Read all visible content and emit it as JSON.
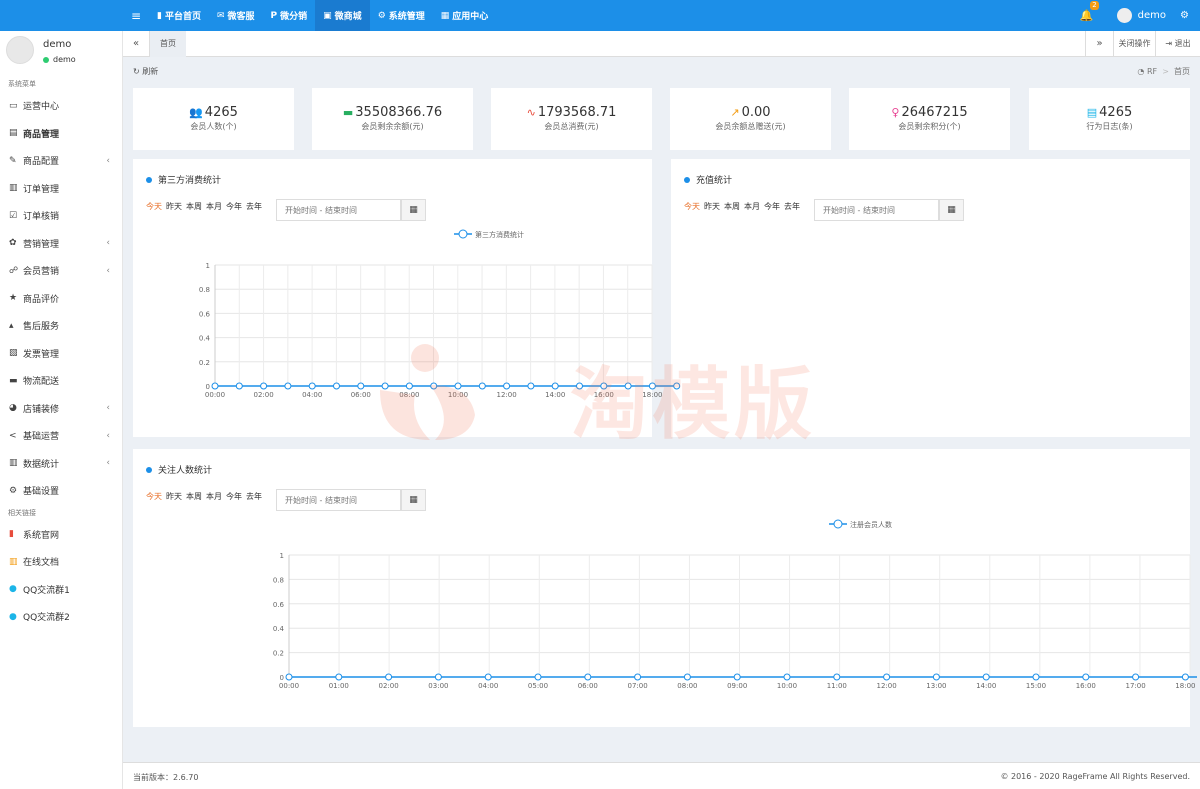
{
  "topbar": {
    "menu_icon": "menu-icon",
    "nav": [
      {
        "label": "平台首页",
        "icon": "bookmark-icon",
        "active": false
      },
      {
        "label": "微客服",
        "icon": "comments-icon",
        "active": false
      },
      {
        "label": "微分销",
        "icon": "p-icon",
        "active": false
      },
      {
        "label": "微商城",
        "icon": "shopping-bag-icon",
        "active": true
      },
      {
        "label": "系统管理",
        "icon": "cogs-icon",
        "active": false
      },
      {
        "label": "应用中心",
        "icon": "app-grid-icon",
        "active": false
      }
    ],
    "notification_count": "2",
    "username": "demo",
    "accent": "#1c8fe8"
  },
  "sidebar": {
    "profile_name": "demo",
    "profile_status": "demo",
    "section_system": "系统菜单",
    "items": [
      {
        "label": "运营中心",
        "icon": "desktop-icon",
        "arrow": false,
        "active": false
      },
      {
        "label": "商品管理",
        "icon": "archive-icon",
        "arrow": false,
        "active": true
      },
      {
        "label": "商品配置",
        "icon": "pencil-icon",
        "arrow": true,
        "active": false
      },
      {
        "label": "订单管理",
        "icon": "list-icon",
        "arrow": false,
        "active": false
      },
      {
        "label": "订单核销",
        "icon": "check-list-icon",
        "arrow": false,
        "active": false
      },
      {
        "label": "营销管理",
        "icon": "gift-icon",
        "arrow": true,
        "active": false
      },
      {
        "label": "会员营销",
        "icon": "handshake-icon",
        "arrow": true,
        "active": false
      },
      {
        "label": "商品评价",
        "icon": "star-icon",
        "arrow": false,
        "active": false
      },
      {
        "label": "售后服务",
        "icon": "fire-extinguisher-icon",
        "arrow": false,
        "active": false
      },
      {
        "label": "发票管理",
        "icon": "invoice-icon",
        "arrow": false,
        "active": false
      },
      {
        "label": "物流配送",
        "icon": "truck-icon",
        "arrow": false,
        "active": false
      },
      {
        "label": "店铺装修",
        "icon": "palette-icon",
        "arrow": true,
        "active": false
      },
      {
        "label": "基础运营",
        "icon": "share-icon",
        "arrow": true,
        "active": false
      },
      {
        "label": "数据统计",
        "icon": "bar-chart-icon",
        "arrow": true,
        "active": false
      },
      {
        "label": "基础设置",
        "icon": "gear-icon",
        "arrow": false,
        "active": false
      }
    ],
    "section_links": "相关链接",
    "links": [
      {
        "label": "系统官网",
        "icon": "bookmark-icon",
        "color": "#e74c3c"
      },
      {
        "label": "在线文档",
        "icon": "list-icon",
        "color": "#f39c12"
      },
      {
        "label": "QQ交流群1",
        "icon": "qq-icon",
        "color": "#1cb5e8"
      },
      {
        "label": "QQ交流群2",
        "icon": "qq-icon",
        "color": "#1cb5e8"
      }
    ]
  },
  "tabs": {
    "prev_icon": "«",
    "home_tab": "首页",
    "next_icon": "»",
    "close_ops": "关闭操作",
    "logout": "退出"
  },
  "breadcrumb": {
    "refresh": "刷新",
    "root": "RF",
    "separator": ">",
    "current": "首页"
  },
  "stats": [
    {
      "value": "4265",
      "label": "会员人数(个)",
      "icon": "users-icon",
      "color": "#1c8fe8"
    },
    {
      "value": "35508366.76",
      "label": "会员剩余余额(元)",
      "icon": "credit-card-icon",
      "color": "#27ae60"
    },
    {
      "value": "1793568.71",
      "label": "会员总消费(元)",
      "icon": "heartbeat-icon",
      "color": "#e74c3c"
    },
    {
      "value": "0.00",
      "label": "会员余额总赠送(元)",
      "icon": "line-chart-icon",
      "color": "#f39c12"
    },
    {
      "value": "26467215",
      "label": "会员剩余积分(个)",
      "icon": "lightbulb-icon",
      "color": "#e84393"
    },
    {
      "value": "4265",
      "label": "行为日志(条)",
      "icon": "list-alt-icon",
      "color": "#1cb5e8"
    }
  ],
  "filters": [
    "今天",
    "昨天",
    "本周",
    "本月",
    "今年",
    "去年"
  ],
  "date_placeholder": "开始时间 - 结束时间",
  "panels": {
    "third_party": {
      "title": "第三方消费统计"
    },
    "recharge": {
      "title": "充值统计"
    },
    "follow": {
      "title": "关注人数统计"
    }
  },
  "watermark": "淘模版",
  "chart_data": [
    {
      "type": "line",
      "title": "",
      "series": [
        {
          "name": "第三方消费统计",
          "values": [
            0,
            0,
            0,
            0,
            0,
            0,
            0,
            0,
            0,
            0,
            0,
            0,
            0,
            0,
            0,
            0,
            0,
            0,
            0,
            0
          ]
        }
      ],
      "x": [
        "00:00",
        "01:00",
        "02:00",
        "03:00",
        "04:00",
        "05:00",
        "06:00",
        "07:00",
        "08:00",
        "09:00",
        "10:00",
        "11:00",
        "12:00",
        "13:00",
        "14:00",
        "15:00",
        "16:00",
        "17:00",
        "18:00",
        "19:00"
      ],
      "x_tick_labels": [
        "00:00",
        "02:00",
        "04:00",
        "06:00",
        "08:00",
        "10:00",
        "12:00",
        "14:00",
        "16:00",
        "18:00"
      ],
      "ylim": [
        0,
        1
      ],
      "yticks": [
        "0",
        "0.2",
        "0.4",
        "0.6",
        "0.8",
        "1"
      ],
      "grid": true,
      "legend": "top-center",
      "color": "#1c8fe8"
    },
    {
      "type": "line",
      "title": "",
      "series": [
        {
          "name": "注册会员人数",
          "values": [
            0,
            0,
            0,
            0,
            0,
            0,
            0,
            0,
            0,
            0,
            0,
            0,
            0,
            0,
            0,
            0,
            0,
            0,
            0
          ]
        }
      ],
      "x": [
        "00:00",
        "01:00",
        "02:00",
        "03:00",
        "04:00",
        "05:00",
        "06:00",
        "07:00",
        "08:00",
        "09:00",
        "10:00",
        "11:00",
        "12:00",
        "13:00",
        "14:00",
        "15:00",
        "16:00",
        "17:00",
        "18:00"
      ],
      "x_tick_labels": [
        "00:00",
        "01:00",
        "02:00",
        "03:00",
        "04:00",
        "05:00",
        "06:00",
        "07:00",
        "08:00",
        "09:00",
        "10:00",
        "11:00",
        "12:00",
        "13:00",
        "14:00",
        "15:00",
        "16:00",
        "17:00",
        "18:00"
      ],
      "ylim": [
        0,
        1
      ],
      "yticks": [
        "0",
        "0.2",
        "0.4",
        "0.6",
        "0.8",
        "1"
      ],
      "grid": true,
      "legend": "top-center",
      "color": "#1c8fe8"
    }
  ],
  "footer": {
    "version": "当前版本：2.6.70",
    "copyright": "© 2016 - 2020 RageFrame All Rights Reserved."
  }
}
